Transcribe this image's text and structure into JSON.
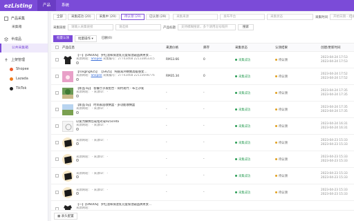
{
  "brand": {
    "name": "ezListing",
    "accent": "#7b4bd8"
  },
  "topnav": [
    {
      "label": "产品",
      "active": true
    },
    {
      "label": "系统",
      "active": false
    }
  ],
  "sidebar": {
    "group1": {
      "label": "产品采集",
      "items": [
        {
          "label": "采集箱",
          "active": false
        }
      ]
    },
    "group2": {
      "label": "半成品",
      "items": [
        {
          "label": "公共采集箱",
          "active": true
        }
      ]
    },
    "group3": {
      "label": "上架管理",
      "shops": [
        {
          "label": "Shopee",
          "color": "#f05a2a"
        },
        {
          "label": "Lazada",
          "color": "#f07a1a"
        },
        {
          "label": "TikTok",
          "color": "#222222"
        }
      ]
    }
  },
  "filters": {
    "tabs": [
      {
        "label": "全部",
        "active": false
      },
      {
        "label": "采集成功 (20)",
        "active": false
      },
      {
        "label": "采集中 (29)",
        "active": false
      },
      {
        "label": "待认领 (29)",
        "active": true
      },
      {
        "label": "已认领 (29)",
        "active": false
      }
    ],
    "sel1": "采集来源",
    "sel2": "发布平台",
    "sel3": "采集状态",
    "label_time": "采集时间",
    "time_placeholder": "开始日期 - 结束日期",
    "label_link": "采集链接",
    "link_placeholder": "请输入采集链接",
    "sel4": "请选择",
    "label_product": "产品标题",
    "product_placeholder": "支持模糊搜索，多个请用逗号隔开",
    "search_button": "搜索"
  },
  "actions": {
    "primary": "批量认领",
    "more": "批量操作",
    "delete": "已删(0)"
  },
  "table": {
    "headers": [
      "产品信息",
      "来源价格",
      "库存",
      "采集状态",
      "认领结果",
      "创建/更新时间"
    ],
    "rows": [
      {
        "title": "【一】【ONO0S】 护红温和保湿乳完度保湿霜品牌男女…",
        "sub_prefix": "来源网站：",
        "link": "Shopee",
        "sub_suffix": " 采集编号：27743468 22133863315",
        "price": "RM13.66",
        "stock": "0",
        "status": "采集成功",
        "claim": "待认领",
        "created": "2023-04-24 17:53",
        "updated": "2023-04-24 17:53",
        "thumb": "black"
      },
      {
        "title": "【ronglng925】 【S925】 纯银耳环精致高级感女…",
        "sub_prefix": "来源网站：",
        "link": "Shopee",
        "sub_suffix": " 采集编号：27743468 22133698776",
        "price": "RM35.34",
        "stock": "0",
        "status": "采集成功",
        "claim": "待认领",
        "created": "2023-04-24 17:52",
        "updated": "2023-04-24 17:52",
        "thumb": "pink"
      },
      {
        "title": "【新品 by】 客餐厅沙发组合 - 简约现代 - 布艺沙发",
        "sub_prefix": "来源网站：",
        "link": "",
        "sub_suffix": " - 来源ID： -",
        "price": "-",
        "stock": "-",
        "status": "采集成功",
        "claim": "待认领",
        "created": "2023-04-24 17:35",
        "updated": "2023-04-24 17:35",
        "thumb": "green"
      },
      {
        "title": "【新品 by】 时尚家居收纳盒 - 多功能收纳盒",
        "sub_prefix": "来源网站：",
        "link": "",
        "sub_suffix": " - 来源ID： -",
        "price": "-",
        "stock": "-",
        "status": "采集成功",
        "claim": "待认领",
        "created": "2023-04-24 17:35",
        "updated": "2023-04-24 17:35",
        "thumb": "field"
      },
      {
        "title": "以爱为媒情侣戒指对戒925sreta",
        "sub_prefix": "来源网站：",
        "link": "",
        "sub_suffix": " - 来源ID： -",
        "price": "-",
        "stock": "-",
        "status": "采集成功",
        "claim": "待认领",
        "created": "2023-04-24 16:31",
        "updated": "2023-04-24 16:31",
        "thumb": "ring"
      },
      {
        "title": "",
        "sub_prefix": "来源网站：",
        "link": "",
        "sub_suffix": " - 来源ID： -",
        "price": "-",
        "stock": "-",
        "status": "采集成功",
        "claim": "待认领",
        "created": "2023-04-23 15:33",
        "updated": "2023-04-23 15:33",
        "thumb": "dark"
      },
      {
        "title": "",
        "sub_prefix": "来源网站：",
        "link": "",
        "sub_suffix": " - 来源ID： -",
        "price": "-",
        "stock": "-",
        "status": "采集成功",
        "claim": "待认领",
        "created": "2023-04-23 15:33",
        "updated": "2023-04-23 15:33",
        "thumb": "dark"
      },
      {
        "title": "",
        "sub_prefix": "来源网站：",
        "link": "",
        "sub_suffix": " - 来源ID： -",
        "price": "-",
        "stock": "-",
        "status": "采集成功",
        "claim": "待认领",
        "created": "2023-04-23 15:33",
        "updated": "2023-04-23 15:33",
        "thumb": "dark"
      },
      {
        "title": "",
        "sub_prefix": "来源网站：",
        "link": "",
        "sub_suffix": " - 来源ID： -",
        "price": "-",
        "stock": "-",
        "status": "采集成功",
        "claim": "待认领",
        "created": "2023-04-23 15:33",
        "updated": "2023-04-23 15:33",
        "thumb": "dark"
      },
      {
        "title": "【一】【ONO0S】 护红温和保湿乳完度保湿霜品牌男女…",
        "sub_prefix": "来源网站：",
        "link": "",
        "sub_suffix": "",
        "price": "",
        "stock": "",
        "status": "",
        "claim": "",
        "created": "",
        "updated": "",
        "thumb": "black"
      }
    ]
  },
  "footer": {
    "label": "表头配置"
  }
}
